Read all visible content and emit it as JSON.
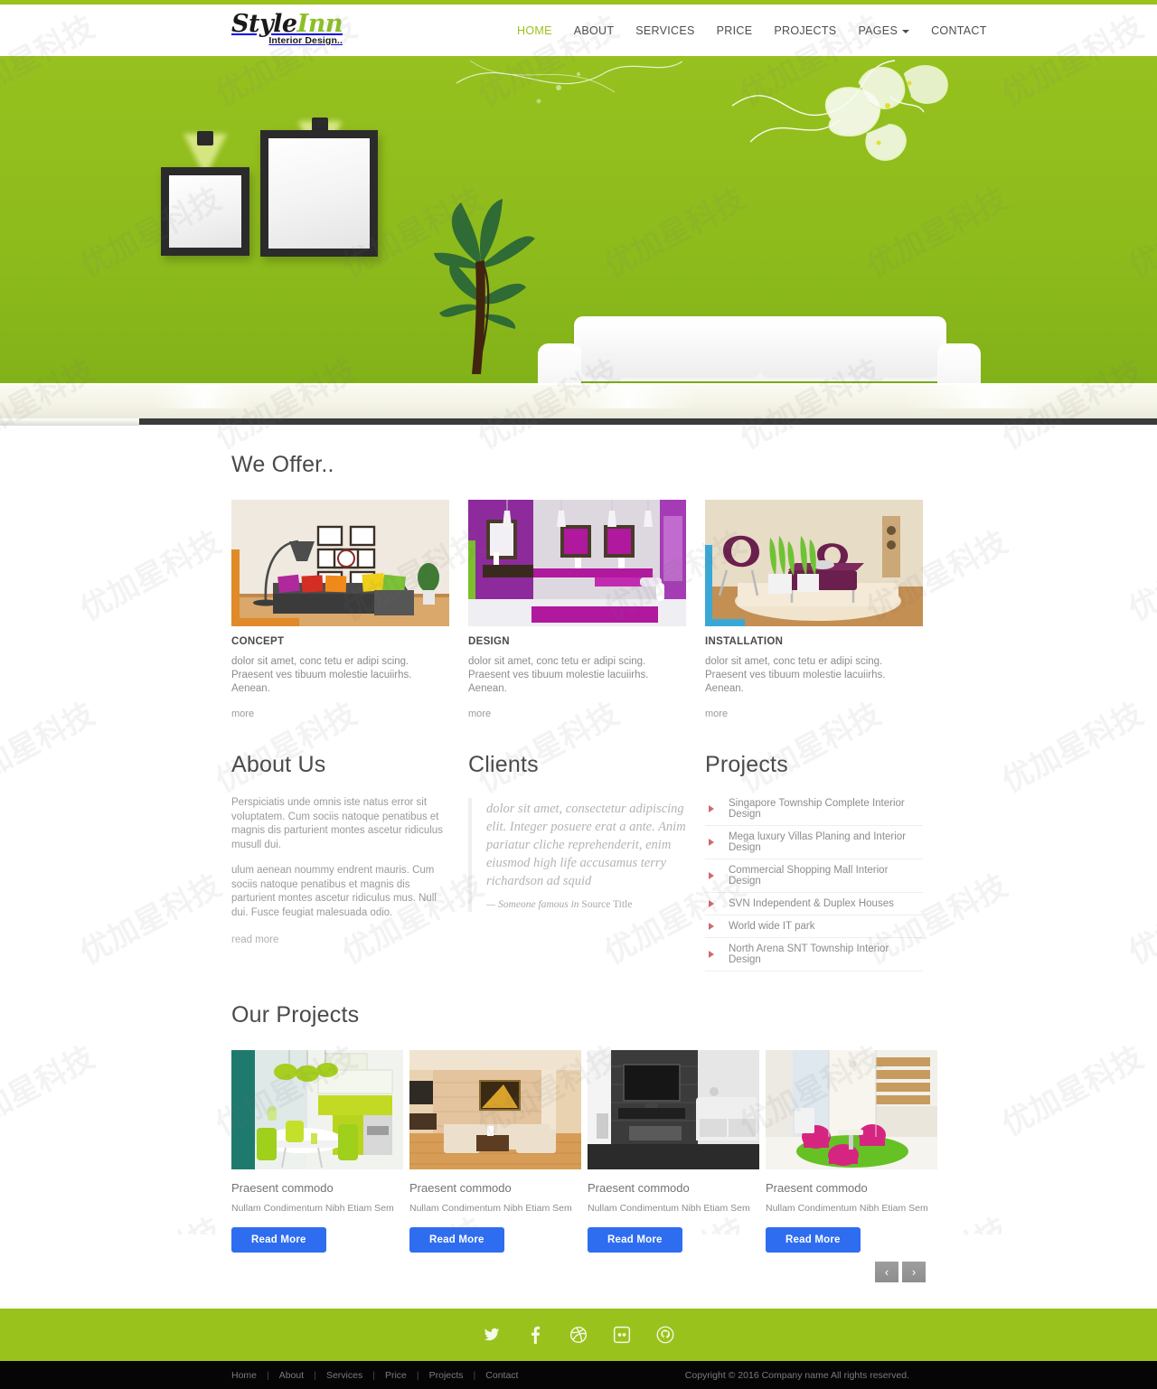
{
  "brand": {
    "name_part1": "Style",
    "name_part2": "Inn",
    "tagline": "Interior Design..",
    "accent_color": "#9ac21c"
  },
  "nav": {
    "items": [
      {
        "label": "HOME",
        "active": true
      },
      {
        "label": "ABOUT",
        "active": false
      },
      {
        "label": "SERVICES",
        "active": false
      },
      {
        "label": "PRICE",
        "active": false
      },
      {
        "label": "PROJECTS",
        "active": false
      },
      {
        "label": "PAGES",
        "active": false,
        "has_dropdown": true
      },
      {
        "label": "CONTACT",
        "active": false
      }
    ]
  },
  "hero": {
    "alt": "green-wall-living-room-with-white-sofa",
    "slider_progress_percent": 12
  },
  "we_offer": {
    "title": "We Offer..",
    "cards": [
      {
        "title": "CONCEPT",
        "text": "dolor sit amet, conc tetu er adipi scing. Praesent ves tibuum molestie lacuiirhs. Aenean.",
        "more_label": "more",
        "image": "living-room-grey-sofa-colorful-cushions",
        "accent": "#e08a2a"
      },
      {
        "title": "DESIGN",
        "text": "dolor sit amet, conc tetu er adipi scing. Praesent ves tibuum molestie lacuiirhs. Aenean.",
        "more_label": "more",
        "image": "purple-bathroom-interior",
        "accent": "#7bbf2a"
      },
      {
        "title": "INSTALLATION",
        "text": "dolor sit amet, conc tetu er adipi scing. Praesent ves tibuum molestie lacuiirhs. Aenean.",
        "more_label": "more",
        "image": "purple-lounge-chairs-beige-rug",
        "accent": "#3aa8d6"
      }
    ]
  },
  "about": {
    "title": "About Us",
    "paragraph1": "Perspiciatis unde omnis iste natus error sit voluptatem. Cum sociis natoque penatibus et magnis dis parturient montes ascetur ridiculus musull dui.",
    "paragraph2": "ulum aenean noummy endrent mauris. Cum sociis natoque penatibus et magnis dis parturient montes ascetur ridiculus mus. Null dui. Fusce feugiat malesuada odio.",
    "read_more_label": "read more"
  },
  "clients": {
    "title": "Clients",
    "quote": "dolor sit amet, consectetur adipiscing elit. Integer posuere erat a ante. Anim pariatur cliche reprehenderit, enim eiusmod high life accusamus terry richardson ad squid",
    "attribution_dash": "— ",
    "attribution_who": "Someone famous in ",
    "attribution_source": "Source Title"
  },
  "projects_list": {
    "title": "Projects",
    "items": [
      "Singapore Township Complete Interior Design",
      "Mega luxury Villas Planing and Interior Design",
      "Commercial Shopping Mall Interior Design",
      "SVN Independent & Duplex Houses",
      "World wide IT park",
      "North Arena SNT Township Interior Design"
    ]
  },
  "our_projects": {
    "title": "Our Projects",
    "cards": [
      {
        "name": "Praesent commodo",
        "subtitle": "Nullam Condimentum Nibh Etiam Sem",
        "button_label": "Read More",
        "image": "green-yellow-kitchen-dining"
      },
      {
        "name": "Praesent commodo",
        "subtitle": "Nullam Condimentum Nibh Etiam Sem",
        "button_label": "Read More",
        "image": "beige-living-room-sectional-sofa"
      },
      {
        "name": "Praesent commodo",
        "subtitle": "Nullam Condimentum Nibh Etiam Sem",
        "button_label": "Read More",
        "image": "dark-grey-living-room-tv"
      },
      {
        "name": "Praesent commodo",
        "subtitle": "Nullam Condimentum Nibh Etiam Sem",
        "button_label": "Read More",
        "image": "white-room-pink-chairs-green-rug"
      }
    ],
    "pager": {
      "prev": "‹",
      "next": "›"
    }
  },
  "footer": {
    "social": [
      {
        "name": "twitter-icon",
        "glyph": "twitter"
      },
      {
        "name": "facebook-icon",
        "glyph": "facebook"
      },
      {
        "name": "dribbble-icon",
        "glyph": "dribbble"
      },
      {
        "name": "flickr-icon",
        "glyph": "flickr"
      },
      {
        "name": "github-icon",
        "glyph": "github"
      }
    ],
    "bar_color": "#9ac21c",
    "links": [
      "Home",
      "About",
      "Services",
      "Price",
      "Projects",
      "Contact"
    ],
    "separator": "|",
    "copyright": "Copyright © 2016 Company name All rights reserved."
  },
  "watermark": {
    "text": "优加星科技"
  }
}
